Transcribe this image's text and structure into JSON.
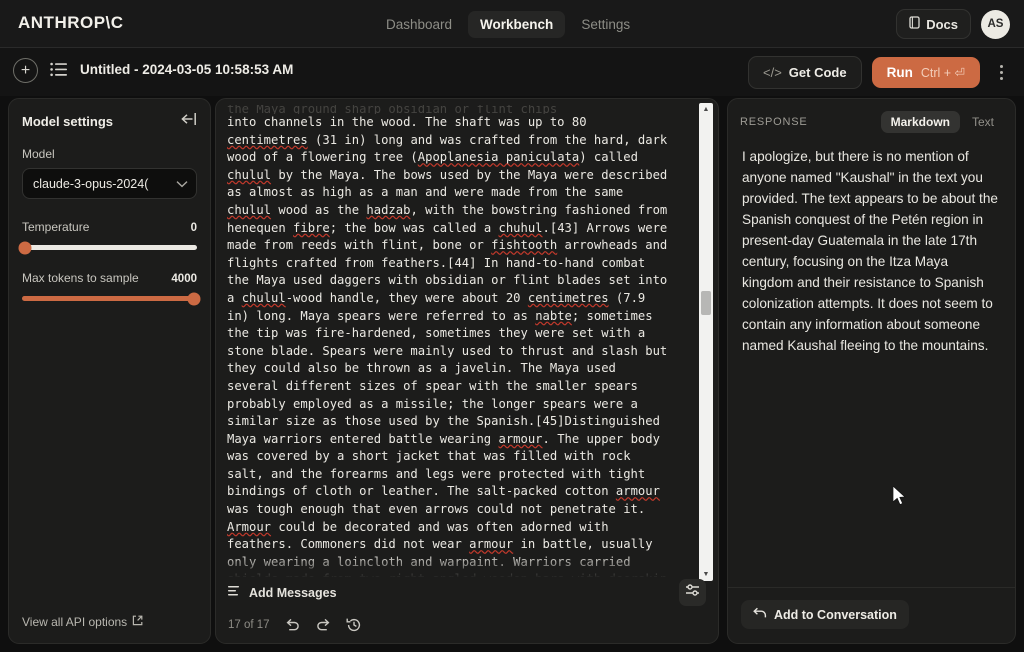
{
  "brand": "ANTHROP\\C",
  "nav": {
    "links": [
      {
        "label": "Dashboard",
        "active": false
      },
      {
        "label": "Workbench",
        "active": true
      },
      {
        "label": "Settings",
        "active": false
      }
    ],
    "docs_label": "Docs",
    "avatar_initials": "AS"
  },
  "toolbar": {
    "doc_title": "Untitled - 2024-03-05 10:58:53 AM",
    "get_code_label": "Get Code",
    "get_code_glyph": "</>",
    "run_label": "Run",
    "run_shortcut": "Ctrl + ⏎"
  },
  "sidebar": {
    "title": "Model settings",
    "model_label": "Model",
    "model_value": "claude-3-opus-2024(",
    "temperature_label": "Temperature",
    "temperature_value": "0",
    "max_tokens_label": "Max tokens to sample",
    "max_tokens_value": "4000",
    "api_options_label": "View all API options"
  },
  "editor": {
    "ghost_line": "the Maya ground sharp obsidian or flint chips",
    "segments": [
      {
        "t": "into channels in the wood. The shaft was up to 80\n"
      },
      {
        "t": "centimetres",
        "sq": true
      },
      {
        "t": " (31 in) long and was crafted from the hard, dark\nwood of a flowering tree ("
      },
      {
        "t": "Apoplanesia paniculata",
        "sq": true
      },
      {
        "t": ") called\n"
      },
      {
        "t": "chulul",
        "sq": true
      },
      {
        "t": " by the Maya. The bows used by the Maya were described\nas almost as high as a man and were made from the same\n"
      },
      {
        "t": "chulul",
        "sq": true
      },
      {
        "t": " wood as the "
      },
      {
        "t": "hadzab",
        "sq": true
      },
      {
        "t": ", with the bowstring fashioned from\nhenequen "
      },
      {
        "t": "fibre",
        "sq": true
      },
      {
        "t": "; the bow was called a "
      },
      {
        "t": "chuhul",
        "sq": true
      },
      {
        "t": ".[43] Arrows were\nmade from reeds with flint, bone or "
      },
      {
        "t": "fishtooth",
        "sq": true
      },
      {
        "t": " arrowheads and\nflights crafted from feathers.[44] In hand-to-hand combat\nthe Maya used daggers with obsidian or flint blades set into\na "
      },
      {
        "t": "chulul",
        "sq": true
      },
      {
        "t": "-wood handle, they were about 20 "
      },
      {
        "t": "centimetres",
        "sq": true
      },
      {
        "t": " (7.9\nin) long. Maya spears were referred to as "
      },
      {
        "t": "nabte",
        "sq": true
      },
      {
        "t": "; sometimes\nthe tip was fire-hardened, sometimes they were set with a\nstone blade. Spears were mainly used to thrust and slash but\nthey could also be thrown as a javelin. The Maya used\nseveral different sizes of spear with the smaller spears\nprobably employed as a missile; the longer spears were a\nsimilar size as those used by the Spanish.[45]Distinguished\nMaya warriors entered battle wearing "
      },
      {
        "t": "armour",
        "sq": true
      },
      {
        "t": ". The upper body\nwas covered by a short jacket that was filled with rock\nsalt, and the forearms and legs were protected with tight\nbindings of cloth or leather. The salt-packed cotton "
      },
      {
        "t": "armour",
        "sq": true
      },
      {
        "t": "\nwas tough enough that even arrows could not penetrate it.\n"
      },
      {
        "t": "Armour",
        "sq": true
      },
      {
        "t": " could be decorated and was often adorned with\nfeathers. Commoners did not wear "
      },
      {
        "t": "armour",
        "sq": true
      },
      {
        "t": " in battle, usually\nonly wearing a loincloth and warpaint. Warriors carried\nshields made from two right-angled wooden bars with deerskin"
      }
    ],
    "add_messages_label": "Add Messages",
    "page_count": "17 of 17"
  },
  "response": {
    "header_label": "RESPONSE",
    "view_modes": [
      {
        "label": "Markdown",
        "active": true
      },
      {
        "label": "Text",
        "active": false
      }
    ],
    "body": "I apologize, but there is no mention of anyone named \"Kaushal\" in the text you provided. The text appears to be about the Spanish conquest of the Petén region in present-day Guatemala in the late 17th century, focusing on the Itza Maya kingdom and their resistance to Spanish colonization attempts. It does not seem to contain any information about someone named Kaushal fleeing to the mountains.",
    "add_to_conversation_label": "Add to Conversation"
  },
  "colors": {
    "accent": "#cc6a43",
    "page_bg": "#0f0f0f",
    "panel_bg": "#1c1c1b",
    "spellcheck": "#c0392b"
  }
}
